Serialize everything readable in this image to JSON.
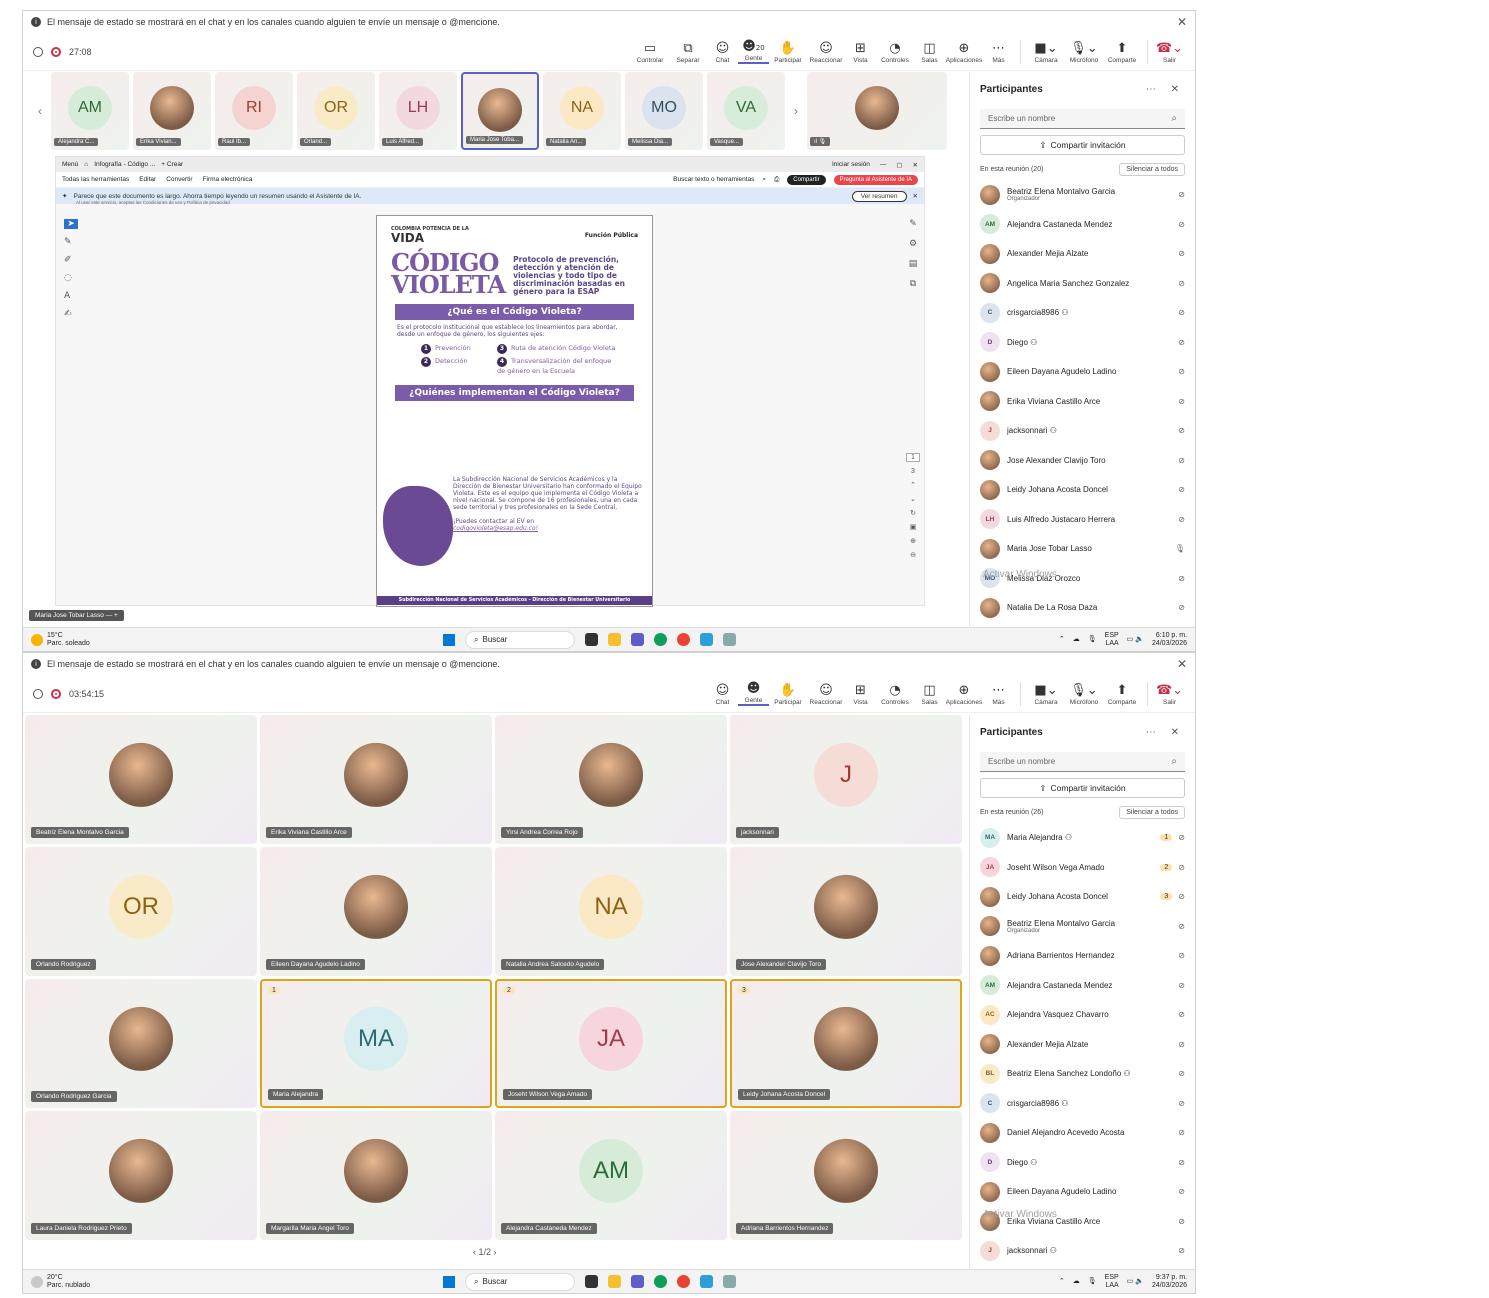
{
  "notice": "El mensaje de estado se mostrará en el chat y en los canales cuando alguien te envíe un mensaje o @mencione.",
  "toolbar_labels": {
    "controlar": "Controlar",
    "separar": "Separar",
    "chat": "Chat",
    "gente": "Gente",
    "participar": "Participar",
    "reaccionar": "Reaccionar",
    "vista": "Vista",
    "controles": "Controles",
    "salas": "Salas",
    "aplicaciones": "Aplicaciones",
    "mas": "Más",
    "camara": "Cámara",
    "microfono": "Micrófono",
    "compartir": "Comparte",
    "salir": "Salir"
  },
  "colors": {
    "accent": "#5b5fc7",
    "leave": "#c4314b",
    "raised_hand": "#e0a41a",
    "poster_purple": "#7b5cab"
  },
  "p1": {
    "timer": "27:08",
    "people_count": "20",
    "strip": [
      {
        "initials": "AM",
        "label": "Alejandra C...",
        "bg": "#d6ecd8",
        "fg": "#2e6b3a"
      },
      {
        "initials": "",
        "label": "Erika Vivian...",
        "photo": true
      },
      {
        "initials": "RI",
        "label": "Raul Ib...",
        "bg": "#f4d4d1",
        "fg": "#a33a2f"
      },
      {
        "initials": "OR",
        "label": "Orland...",
        "bg": "#faebc8",
        "fg": "#8a6414"
      },
      {
        "initials": "LH",
        "label": "Luis Alfred...",
        "bg": "#f3d9df",
        "fg": "#9c3a55"
      },
      {
        "initials": "",
        "label": "Maria Jose Toba...",
        "photo": true,
        "selected": true
      },
      {
        "initials": "NA",
        "label": "Natalia An...",
        "bg": "#fbe8c4",
        "fg": "#8a6414"
      },
      {
        "initials": "MO",
        "label": "Melissa Dia...",
        "bg": "#dbe4ee",
        "fg": "#334d68"
      },
      {
        "initials": "VA",
        "label": "Vasque...",
        "bg": "#d7ecd9",
        "fg": "#2e6b3a"
      }
    ],
    "strip_last_label": "",
    "doc": {
      "tab_menu": "Menú",
      "tab_title": "Infografía - Código ...",
      "tab_create": "+ Crear",
      "signin": "Iniciar sesión",
      "menu": [
        "Todas las herramientas",
        "Editar",
        "Convertir",
        "Firma electrónica"
      ],
      "search_tools": "Buscar texto o herramientas",
      "share_btn": "Compartir",
      "ai_btn": "Pregunta al Asistente de IA",
      "ai_notice": "Parece que este documento es largo. Ahorra tiempo leyendo un resumen usando el Asistente de IA.",
      "ai_sub": "Al usar este servicio, aceptas las Condiciones de uso y Política de privacidad",
      "see_summary": "Ver resumen",
      "page_current": "1",
      "page_total": "3"
    },
    "poster": {
      "logo_small": "COLOMBIA POTENCIA DE LA",
      "logo_big": "VIDA",
      "fp": "Función Pública",
      "codigo1": "CÓDIGO",
      "codigo2": "VIOLETA",
      "protocol": "Protocolo de prevención, detección y atención de violencias y todo tipo de discriminación basadas en género para la ESAP",
      "q1": "¿Qué es el Código Violeta?",
      "q1_text": "Es el protocolo institucional que establece los lineamientos para abordar, desde un enfoque de género, los siguientes ejes:",
      "axis1": "Prevención",
      "axis2": "Detección",
      "axis3": "Ruta de atención Código Violeta",
      "axis4": "Transversalización del enfoque de género en la Escuela",
      "q2": "¿Quiénes implementan el Código Violeta?",
      "q2_text": "La Subdirección Nacional de Servicios Académicos y la Dirección de Bienestar Universitario han conformado el Equipo Violeta. Este es el equipo que implementa el Código Violeta a nivel nacional. Se compone de 16 profesionales, una en cada sede territorial y tres profesionales en la Sede Central.",
      "contact": "¡Puedes contactar al EV en",
      "email": "codigovioleta@esap.edu.co!",
      "footer": "Subdirección Nacional de Servicios Académicos - Dirección de Bienestar Universitario"
    },
    "presenter_tag": "Maria Jose Tobar Lasso",
    "sidebar": {
      "title": "Participantes",
      "search_placeholder": "Escribe un nombre",
      "invite": "Compartir invitación",
      "in_meeting": "En esta reunión (20)",
      "mute_all": "Silenciar a todos",
      "people": [
        {
          "name": "Beatriz Elena Montalvo Garcia",
          "sub": "Organizador",
          "photo": true
        },
        {
          "name": "Alejandra Castaneda Mendez",
          "initials": "AM",
          "bg": "#d6ecd8",
          "fg": "#2e6b3a"
        },
        {
          "name": "Alexander Mejia Alzate",
          "photo": true
        },
        {
          "name": "Angelica Maria Sanchez Gonzalez",
          "photo": true
        },
        {
          "name": "crisgarcia8986",
          "initials": "C",
          "bg": "#dbe4ee",
          "fg": "#334d68",
          "ext": true
        },
        {
          "name": "Diego",
          "initials": "D",
          "bg": "#efe3f3",
          "fg": "#6b3b80",
          "ext": true
        },
        {
          "name": "Eileen Dayana Agudelo Ladino",
          "photo": true
        },
        {
          "name": "Erika Viviana Castillo Arce",
          "photo": true
        },
        {
          "name": "jacksonnari",
          "initials": "J",
          "bg": "#f6dcd6",
          "fg": "#a33a2f",
          "ext": true
        },
        {
          "name": "Jose Alexander Clavijo Toro",
          "photo": true
        },
        {
          "name": "Leidy Johana Acosta Doncel",
          "photo": true
        },
        {
          "name": "Luis Alfredo Justacaro Herrera",
          "initials": "LH",
          "bg": "#f3d9df",
          "fg": "#9c3a55"
        },
        {
          "name": "Maria Jose Tobar Lasso",
          "photo": true,
          "mic_on": true
        },
        {
          "name": "Melissa Diaz Orozco",
          "initials": "MO",
          "bg": "#dbe4ee",
          "fg": "#334d68"
        },
        {
          "name": "Natalia De La Rosa Daza",
          "photo": true
        }
      ]
    },
    "watermark": "Activar Windows",
    "watermark_sub": "activar Windows.",
    "taskbar": {
      "temp": "15°C",
      "weather": "Parc. soleado",
      "search": "Buscar",
      "lang": "ESP",
      "lang2": "LAA",
      "time": "6:10 p. m.",
      "date": "24/03/2026"
    }
  },
  "p2": {
    "timer": "03:54:15",
    "tiles": [
      {
        "name": "Beatriz Elena Montalvo Garcia",
        "photo": true
      },
      {
        "name": "Erika Viviana Castillo Arce",
        "photo": true
      },
      {
        "name": "Yirsi Andrea Correa Rojo",
        "photo": true
      },
      {
        "name": "jacksonnari",
        "initials": "J",
        "bg": "#f6dcd6",
        "fg": "#a33a2f"
      },
      {
        "name": "Orlando Rodriguez",
        "initials": "OR",
        "bg": "#faebc8",
        "fg": "#8a6414"
      },
      {
        "name": "Eileen Dayana Agudelo Ladino",
        "photo": true
      },
      {
        "name": "Natalia Andrea Salcedo Agudelo",
        "initials": "NA",
        "bg": "#fbe8c4",
        "fg": "#8a6414"
      },
      {
        "name": "Jose Alexander Clavijo Toro",
        "photo": true
      },
      {
        "name": "Orlando Rodriguez Garcia",
        "photo": true
      },
      {
        "name": "Maria Alejandra",
        "initials": "MA",
        "bg": "#d8eef0",
        "fg": "#2e6b73",
        "hand": "1"
      },
      {
        "name": "Joseht Wilson Vega Amado",
        "initials": "JA",
        "bg": "#f6d6dc",
        "fg": "#a33a4f",
        "hand": "2"
      },
      {
        "name": "Leidy Johana Acosta Doncel",
        "photo": true,
        "hand": "3"
      },
      {
        "name": "Laura Daniela Rodriguez Prieto",
        "photo": true
      },
      {
        "name": "Margarita Maria Angel Toro",
        "photo": true
      },
      {
        "name": "Alejandra Castaneda Mendez",
        "initials": "AM",
        "bg": "#d6ecd8",
        "fg": "#2e6b3a"
      },
      {
        "name": "Adriana Barrientos Hernandez",
        "photo": true
      }
    ],
    "pager": "1/2",
    "sidebar": {
      "title": "Participantes",
      "search_placeholder": "Escribe un nombre",
      "invite": "Compartir invitación",
      "in_meeting": "En esta reunión (26)",
      "mute_all": "Silenciar a todos",
      "people": [
        {
          "name": "Maria Alejandra",
          "initials": "MA",
          "bg": "#d8eef0",
          "fg": "#2e6b73",
          "ext": true,
          "hand": "1"
        },
        {
          "name": "Joseht Wilson Vega Amado",
          "initials": "JA",
          "bg": "#f6d6dc",
          "fg": "#a33a4f",
          "hand": "2"
        },
        {
          "name": "Leidy Johana Acosta Doncel",
          "photo": true,
          "hand": "3"
        },
        {
          "name": "Beatriz Elena Montalvo Garcia",
          "sub": "Organizador",
          "photo": true
        },
        {
          "name": "Adriana Barrientos Hernandez",
          "photo": true
        },
        {
          "name": "Alejandra Castaneda Mendez",
          "initials": "AM",
          "bg": "#d6ecd8",
          "fg": "#2e6b3a"
        },
        {
          "name": "Alejandra Vasquez Chavarro",
          "initials": "AC",
          "bg": "#fbe8c4",
          "fg": "#8a6414"
        },
        {
          "name": "Alexander Mejia Alzate",
          "photo": true
        },
        {
          "name": "Beatriz Elena Sanchez Londoño",
          "initials": "BL",
          "bg": "#faebc8",
          "fg": "#8a6414",
          "ext": true
        },
        {
          "name": "crisgarcia8986",
          "initials": "C",
          "bg": "#dbe4ee",
          "fg": "#334d68",
          "ext": true
        },
        {
          "name": "Daniel Alejandro Acevedo Acosta",
          "photo": true
        },
        {
          "name": "Diego",
          "initials": "D",
          "bg": "#efe3f3",
          "fg": "#6b3b80",
          "ext": true
        },
        {
          "name": "Eileen Dayana Agudelo Ladino",
          "photo": true
        },
        {
          "name": "Erika Viviana Castillo Arce",
          "photo": true
        },
        {
          "name": "jacksonnari",
          "initials": "J",
          "bg": "#f6dcd6",
          "fg": "#a33a2f",
          "ext": true
        }
      ]
    },
    "watermark": "Activar Windows",
    "watermark_sub": "ar Windows.",
    "taskbar": {
      "temp": "20°C",
      "weather": "Parc. nublado",
      "search": "Buscar",
      "lang": "ESP",
      "lang2": "LAA",
      "time": "9:37 p. m.",
      "date": "24/03/2026"
    }
  }
}
